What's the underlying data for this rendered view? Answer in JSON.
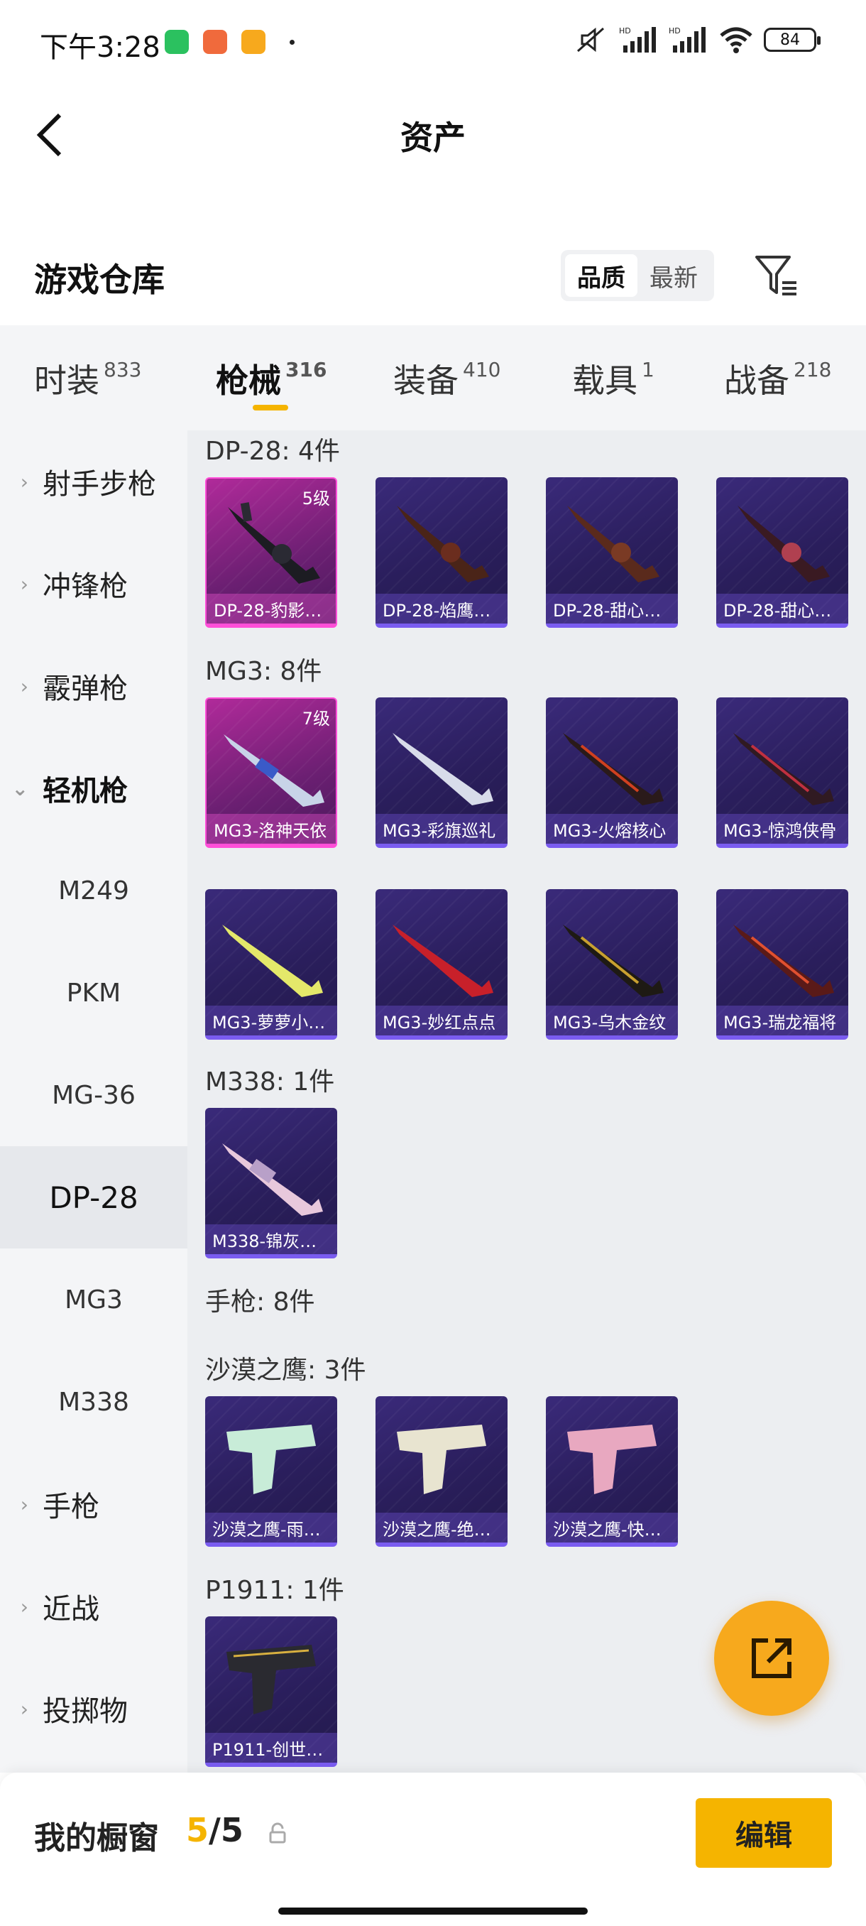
{
  "status_bar": {
    "time": "下午3:28",
    "battery": "84",
    "icons": [
      "wechat-icon",
      "app-red-icon",
      "app-orange-icon",
      "mute-icon",
      "hd-signal-icon",
      "hd-signal-icon",
      "wifi-icon",
      "battery-icon"
    ]
  },
  "header": {
    "title": "资产",
    "back_icon": "chevron-left-icon"
  },
  "warehouse": {
    "title": "游戏仓库",
    "sort_options": [
      "品质",
      "最新"
    ],
    "sort_active": "品质",
    "filter_icon": "filter-icon"
  },
  "category_tabs": [
    {
      "label": "时装",
      "count": "833"
    },
    {
      "label": "枪械",
      "count": "316",
      "active": true
    },
    {
      "label": "装备",
      "count": "410"
    },
    {
      "label": "载具",
      "count": "1"
    },
    {
      "label": "战备",
      "count": "218"
    }
  ],
  "sidebar": [
    {
      "label": "射手步枪",
      "type": "category"
    },
    {
      "label": "冲锋枪",
      "type": "category"
    },
    {
      "label": "霰弹枪",
      "type": "category"
    },
    {
      "label": "轻机枪",
      "type": "category-expanded"
    },
    {
      "label": "M249",
      "type": "sub"
    },
    {
      "label": "PKM",
      "type": "sub"
    },
    {
      "label": "MG-36",
      "type": "sub"
    },
    {
      "label": "DP-28",
      "type": "sub-selected"
    },
    {
      "label": "MG3",
      "type": "sub"
    },
    {
      "label": "M338",
      "type": "sub"
    },
    {
      "label": "手枪",
      "type": "category"
    },
    {
      "label": "近战",
      "type": "category"
    },
    {
      "label": "投掷物",
      "type": "category"
    }
  ],
  "groups": [
    {
      "title": "DP-28: 4件",
      "items": [
        {
          "name": "DP-28-豹影…",
          "level": "5级",
          "rarity": "pink"
        },
        {
          "name": "DP-28-焰鹰…",
          "rarity": "purple"
        },
        {
          "name": "DP-28-甜心…",
          "rarity": "purple"
        },
        {
          "name": "DP-28-甜心…",
          "rarity": "purple"
        }
      ]
    },
    {
      "title": "MG3: 8件",
      "items": [
        {
          "name": "MG3-洛神天依",
          "level": "7级",
          "rarity": "pink"
        },
        {
          "name": "MG3-彩旗巡礼",
          "rarity": "purple"
        },
        {
          "name": "MG3-火熔核心",
          "rarity": "purple"
        },
        {
          "name": "MG3-惊鸿侠骨",
          "rarity": "purple"
        },
        {
          "name": "MG3-萝萝小…",
          "rarity": "purple"
        },
        {
          "name": "MG3-妙红点点",
          "rarity": "purple"
        },
        {
          "name": "MG3-乌木金纹",
          "rarity": "purple"
        },
        {
          "name": "MG3-瑞龙福将",
          "rarity": "purple"
        }
      ]
    },
    {
      "title": "M338: 1件",
      "items": [
        {
          "name": "M338-锦灰…",
          "rarity": "purple"
        }
      ]
    },
    {
      "title": "手枪: 8件",
      "items": []
    },
    {
      "title": "沙漠之鹰: 3件",
      "items": [
        {
          "name": "沙漠之鹰-雨…",
          "rarity": "purple"
        },
        {
          "name": "沙漠之鹰-绝…",
          "rarity": "purple"
        },
        {
          "name": "沙漠之鹰-快…",
          "rarity": "purple"
        }
      ]
    },
    {
      "title": "P1911: 1件",
      "items": [
        {
          "name": "P1911-创世…",
          "rarity": "purple"
        }
      ]
    }
  ],
  "fab": {
    "icon": "share-icon"
  },
  "bottom_bar": {
    "label": "我的橱窗",
    "used": "5",
    "separator": "/",
    "total": "5",
    "lock_icon": "lock-icon",
    "edit_label": "编辑"
  },
  "colors": {
    "accent": "#f5b400",
    "fab": "#f7a91d",
    "rare_pink": "#ff4fd8",
    "rare_purple": "#7a5cf0"
  }
}
